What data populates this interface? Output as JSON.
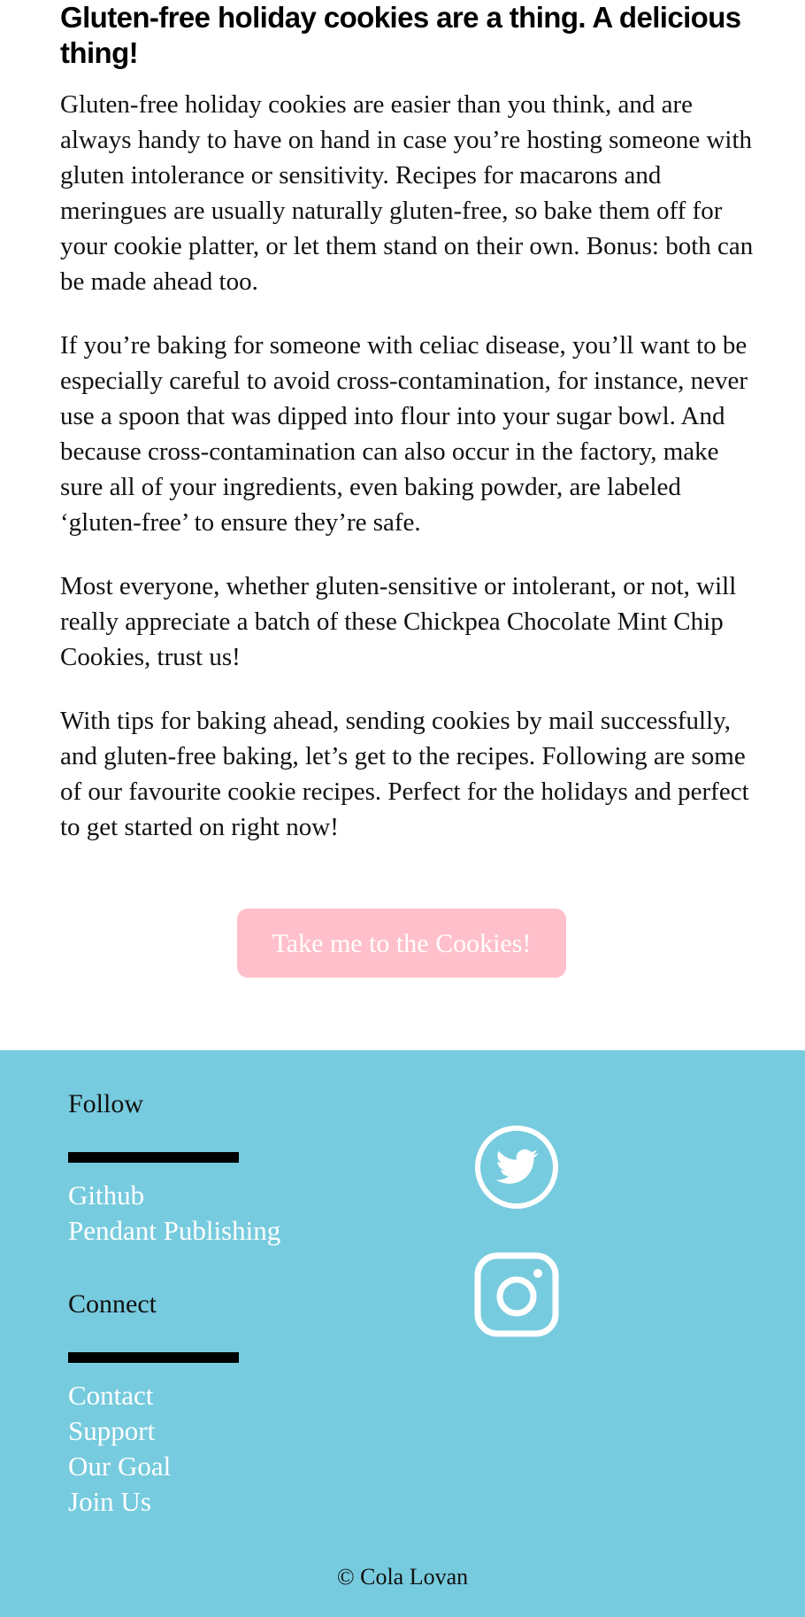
{
  "article": {
    "heading": "Gluten-free holiday cookies are a thing. A delicious thing!",
    "paragraphs": [
      "Gluten-free holiday cookies are easier than you think, and are always handy to have on hand in case you’re hosting someone with gluten intolerance or sensitivity. Recipes for macarons and meringues are usually naturally gluten-free, so bake them off for your cookie platter, or let them stand on their own. Bonus: both can be made ahead too.",
      "If you’re baking for someone with celiac disease, you’ll want to be especially careful to avoid cross-contamination, for instance, never use a spoon that was dipped into flour into your sugar bowl. And because cross-contamination can also occur in the factory, make sure all of your ingredients, even baking powder, are labeled ‘gluten-free’ to ensure they’re safe.",
      "Most everyone, whether gluten-sensitive or intolerant, or not, will really appreciate a batch of these Chickpea Chocolate Mint Chip Cookies, trust us!",
      "With tips for baking ahead, sending cookies by mail successfully, and gluten-free baking, let’s get to the recipes. Following are some of our favourite cookie recipes. Perfect for the holidays and perfect to get started on right now!"
    ],
    "cta_label": "Take me to the Cookies!"
  },
  "footer": {
    "follow_heading": "Follow",
    "follow_links": [
      "Github",
      "Pendant Publishing"
    ],
    "connect_heading": "Connect",
    "connect_links": [
      "Contact",
      "Support",
      "Our Goal",
      "Join Us"
    ],
    "social_icons": [
      "twitter-icon",
      "instagram-icon"
    ],
    "copyright": "© Cola Lovan"
  },
  "colors": {
    "footer_bg": "#77cbde",
    "cta_bg": "#ffc0cb",
    "link_text": "#ffffff"
  }
}
